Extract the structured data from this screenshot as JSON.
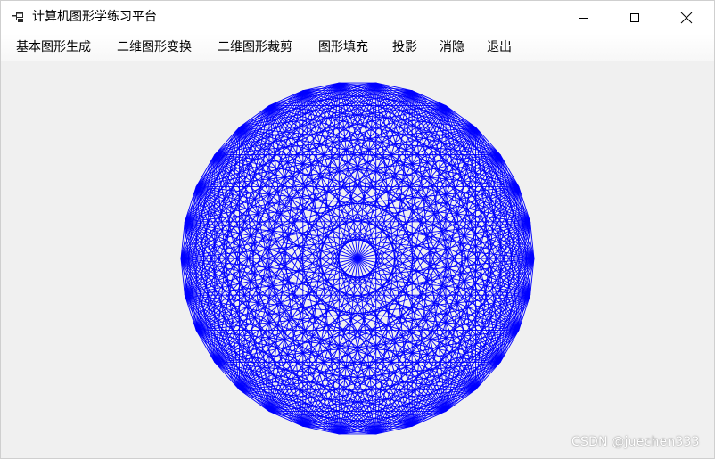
{
  "window": {
    "title": "计算机图形学练习平台",
    "icon": "app-window-icon",
    "controls": [
      "minimize-icon",
      "maximize-icon",
      "close-icon"
    ]
  },
  "menu": {
    "items": [
      {
        "label": "基本图形生成"
      },
      {
        "label": "二维图形变换"
      },
      {
        "label": "二维图形裁剪"
      },
      {
        "label": "图形填充"
      },
      {
        "label": "投影"
      },
      {
        "label": "消隐"
      },
      {
        "label": "退出"
      }
    ]
  },
  "drawing": {
    "type": "diamond pattern",
    "points": 30,
    "stroke_color": "#0000ff",
    "background": "#f0f0f0"
  },
  "watermark": {
    "text": "CSDN @juechen333"
  }
}
